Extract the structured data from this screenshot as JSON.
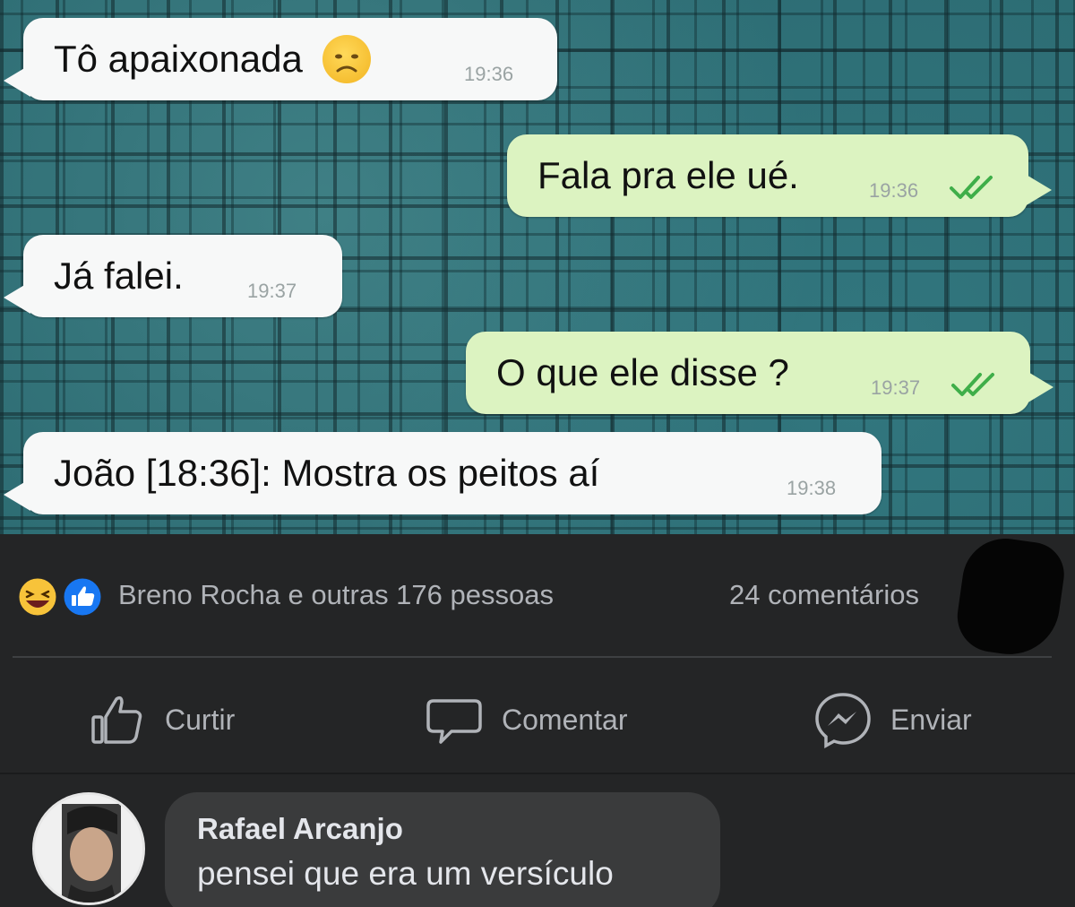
{
  "chat": {
    "messages": [
      {
        "direction": "incoming",
        "text": "Tô apaixonada",
        "emoji": "sad-face-emoji",
        "time": "19:36"
      },
      {
        "direction": "outgoing",
        "text": "Fala pra ele ué.",
        "time": "19:36",
        "read": true
      },
      {
        "direction": "incoming",
        "text": "Já falei.",
        "time": "19:37"
      },
      {
        "direction": "outgoing",
        "text": "O que ele disse ?",
        "time": "19:37",
        "read": true
      },
      {
        "direction": "incoming",
        "text": "João [18:36]: Mostra os peitos aí",
        "time": "19:38"
      }
    ],
    "colors": {
      "incoming_bubble": "#f7f8f8",
      "outgoing_bubble": "#dcf3c1",
      "read_ticks": "#4fc3f7"
    }
  },
  "post": {
    "reactions": {
      "icons": [
        "haha-emoji",
        "like-icon"
      ],
      "text": "Breno Rocha e outras 176 pessoas"
    },
    "comments_count": "24 comentários",
    "actions": [
      {
        "label": "Curtir",
        "icon": "thumbs-up-icon"
      },
      {
        "label": "Comentar",
        "icon": "comment-icon"
      },
      {
        "label": "Enviar",
        "icon": "messenger-icon"
      }
    ]
  },
  "comment": {
    "author": "Rafael Arcanjo",
    "text": "pensei que era um versículo"
  },
  "colors": {
    "fb_background": "#242526",
    "comment_bubble": "#3a3b3c",
    "like_blue": "#1877f2"
  }
}
